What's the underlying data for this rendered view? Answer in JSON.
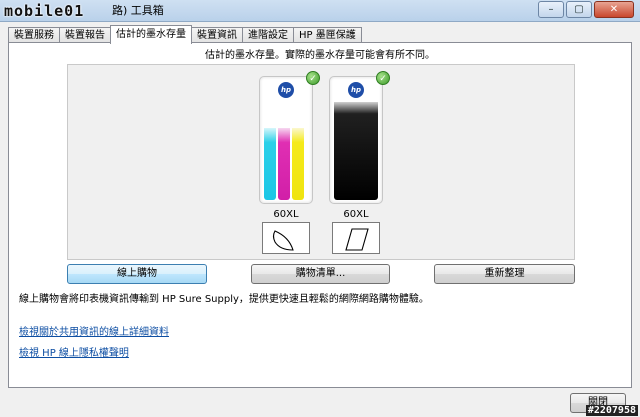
{
  "window": {
    "watermark": "mobile01",
    "title": "路) 工具箱",
    "buttons": [
      "–",
      "▢",
      "✕"
    ]
  },
  "tabs": [
    {
      "label": "裝置服務",
      "active": false
    },
    {
      "label": "裝置報告",
      "active": false
    },
    {
      "label": "估計的墨水存量",
      "active": true
    },
    {
      "label": "裝置資訊",
      "active": false
    },
    {
      "label": "進階設定",
      "active": false
    },
    {
      "label": "HP 墨匣保護",
      "active": false
    }
  ],
  "ink": {
    "heading": "估計的墨水存量。實際的墨水存量可能會有所不同。",
    "cartridges": [
      {
        "label": "60XL",
        "type": "tri-color",
        "colors": [
          "#1bc6e6",
          "#d11fa8",
          "#efe410"
        ],
        "level": 0.6,
        "status": "ok"
      },
      {
        "label": "60XL",
        "type": "black",
        "colors": [
          "#000000"
        ],
        "level": 0.8,
        "status": "ok"
      }
    ]
  },
  "actions": {
    "shop_online": "線上購物",
    "shopping_list": "購物清單...",
    "refresh": "重新整理"
  },
  "description": "線上購物會將印表機資訊傳輸到 HP Sure Supply，提供更快速且輕鬆的網際網路購物體驗。",
  "links": {
    "info_sharing": "檢視關於共用資訊的線上詳細資料",
    "privacy": "檢視 HP 線上隱私權聲明"
  },
  "footer": {
    "close": "關閉",
    "stamp": "#2207958"
  }
}
